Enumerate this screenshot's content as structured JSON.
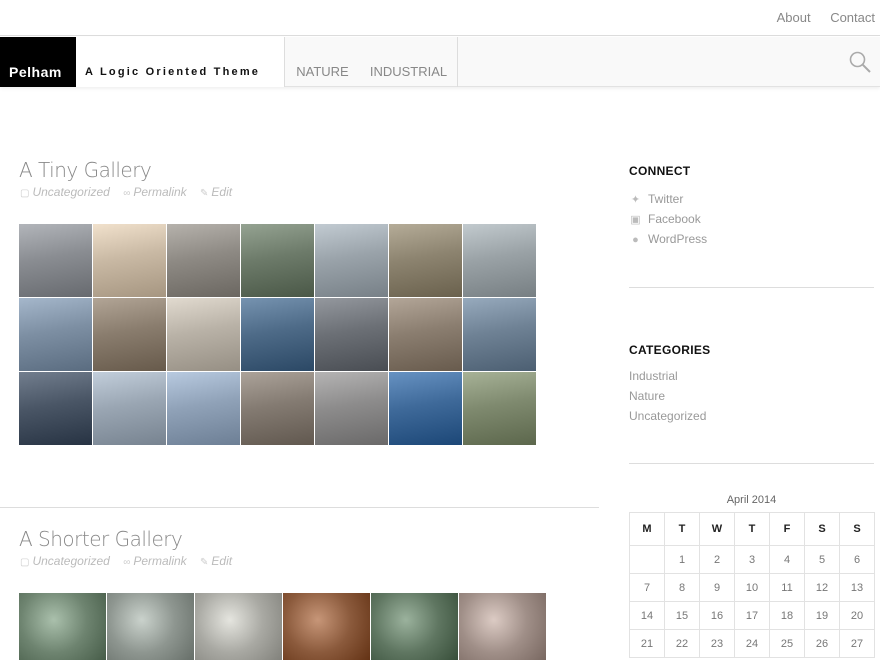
{
  "top_links": [
    "About",
    "Contact"
  ],
  "site": {
    "name": "Pelham",
    "tagline": "A Logic Oriented Theme"
  },
  "nav": [
    "NATURE",
    "INDUSTRIAL"
  ],
  "posts": [
    {
      "title": "A Tiny Gallery",
      "meta": {
        "category": "Uncategorized",
        "permalink": "Permalink",
        "edit": "Edit"
      }
    },
    {
      "title": "A Shorter Gallery",
      "meta": {
        "category": "Uncategorized",
        "permalink": "Permalink",
        "edit": "Edit"
      }
    }
  ],
  "gallery1_colors": [
    [
      "#8a8d92",
      "#c9b9a4",
      "#8e8a84",
      "#6d7b6a",
      "#9aa3aa",
      "#8d8470",
      "#9aa2a6"
    ],
    [
      "#7d8fa3",
      "#8a7d6e",
      "#b9b2a7",
      "#4e6b88",
      "#6c7076",
      "#8b7e70",
      "#6f8295"
    ],
    [
      "#4a5666",
      "#9aa6b3",
      "#90a2b8",
      "#847b72",
      "#8d8c8c",
      "#3f6a9a",
      "#7f8a6f"
    ]
  ],
  "gallery2_colors": [
    "#6e8470",
    "#8e9690",
    "#a9a9a3",
    "#8b5a3c",
    "#5f7661",
    "#a08f88"
  ],
  "sidebar": {
    "connect": {
      "title": "CONNECT",
      "items": [
        {
          "label": "Twitter",
          "icon": "twitter-icon"
        },
        {
          "label": "Facebook",
          "icon": "facebook-icon"
        },
        {
          "label": "WordPress",
          "icon": "wordpress-icon"
        }
      ]
    },
    "categories": {
      "title": "CATEGORIES",
      "items": [
        "Industrial",
        "Nature",
        "Uncategorized"
      ]
    },
    "calendar": {
      "caption": "April 2014",
      "weekdays": [
        "M",
        "T",
        "W",
        "T",
        "F",
        "S",
        "S"
      ],
      "weeks": [
        [
          "",
          "1",
          "2",
          "3",
          "4",
          "5",
          "6"
        ],
        [
          "7",
          "8",
          "9",
          "10",
          "11",
          "12",
          "13"
        ],
        [
          "14",
          "15",
          "16",
          "17",
          "18",
          "19",
          "20"
        ],
        [
          "21",
          "22",
          "23",
          "24",
          "25",
          "26",
          "27"
        ]
      ]
    }
  }
}
